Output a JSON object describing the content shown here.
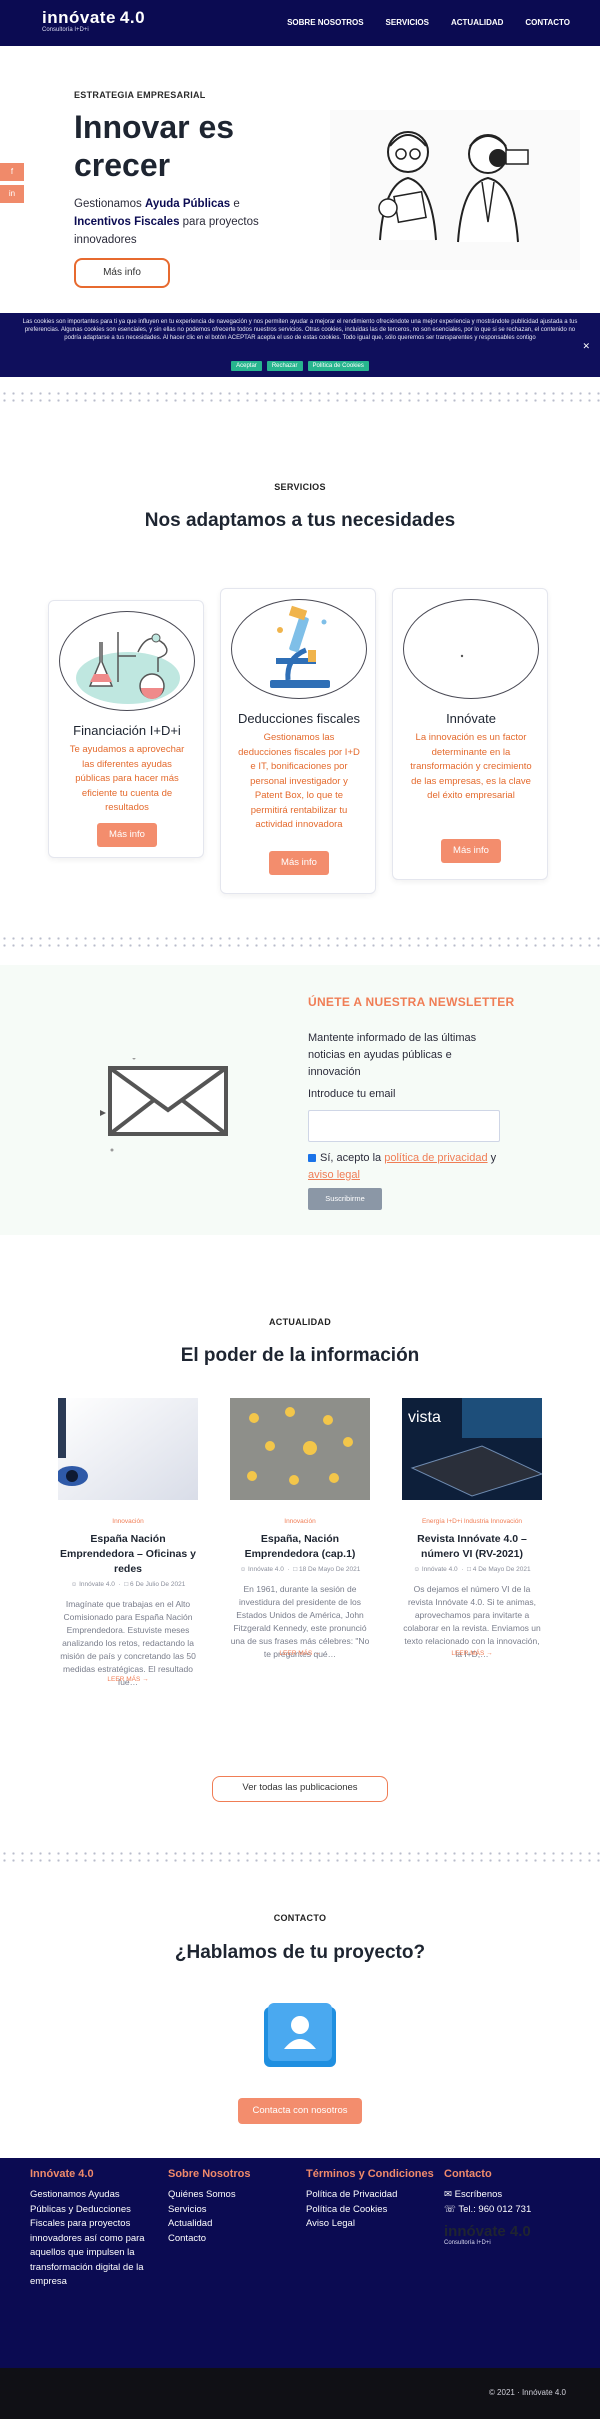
{
  "header": {
    "brand": "innóvate",
    "version": "4.0",
    "tagline": "Consultoría I+D+i",
    "nav": [
      "SOBRE NOSOTROS",
      "SERVICIOS",
      "ACTUALIDAD",
      "CONTACTO"
    ]
  },
  "hero": {
    "eyebrow": "ESTRATEGIA EMPRESARIAL",
    "title": "Innovar es crecer",
    "text_1": "Gestionamos ",
    "text_bold_1": "Ayuda Públicas",
    "text_2": " e ",
    "text_bold_2": "Incentivos Fiscales",
    "text_3": " para proyectos innovadores",
    "button": "Más info",
    "social": [
      "f",
      "in"
    ]
  },
  "cookie": {
    "text": "Las cookies son importantes para ti ya que influyen en tu experiencia de navegación y nos permiten ayudar a mejorar el rendimiento ofreciéndote una mejor experiencia y mostrándote publicidad ajustada a tus preferencias. Algunas cookies son esenciales, y sin ellas no podemos ofrecerte todos nuestros servicios. Otras cookies, incluidas las de terceros, no son esenciales, por lo que si se rechazan, el contenido no podría adaptarse a tus necesidades. Al hacer clic en el botón ACEPTAR acepta el uso de estas cookies. Todo igual que, sólo queremos ser transparentes y responsables contigo",
    "accept": "Aceptar",
    "reject": "Rechazar",
    "policy": "Política de Cookies",
    "close": "✕"
  },
  "services": {
    "eyebrow": "SERVICIOS",
    "title": "Nos adaptamos a tus necesidades",
    "cards": [
      {
        "title": "Financiación I+D+i",
        "text": "Te ayudamos a aprovechar las diferentes ayudas públicas para hacer más eficiente tu cuenta de resultados",
        "button": "Más info"
      },
      {
        "title": "Deducciones fiscales",
        "text": "Gestionamos las deducciones fiscales por I+D e IT, bonificaciones por personal investigador y Patent Box, lo que te permitirá rentabilizar tu actividad innovadora",
        "button": "Más info"
      },
      {
        "title": "Innóvate",
        "text": "La innovación es un factor determinante en la transformación y crecimiento de las empresas, es la clave del éxito empresarial",
        "button": "Más info"
      }
    ]
  },
  "newsletter": {
    "title": "ÚNETE A NUESTRA NEWSLETTER",
    "text": "Mantente informado de las últimas noticias en ayudas públicas e innovación",
    "email_label": "Introduce tu email",
    "email_placeholder": "",
    "consent_1": "Sí, acepto la ",
    "consent_link_1": "política de privacidad",
    "consent_2": " y ",
    "consent_link_2": "aviso legal",
    "button": "Suscribirme"
  },
  "news": {
    "eyebrow": "ACTUALIDAD",
    "title": "El poder de la información",
    "posts": [
      {
        "category": "Innovación",
        "title": "España Nación Emprendedora – Oficinas y redes",
        "author": "Innóvate 4.0",
        "date": "6 De Julio De 2021",
        "excerpt": "Imagínate que trabajas en el Alto Comisionado para España Nación Emprendedora. Estuviste meses analizando los retos, redactando la misión de país y concretando las 50 medidas estratégicas. El resultado fue…",
        "more": "LEER MÁS"
      },
      {
        "category": "Innovación",
        "title": "España, Nación Emprendedora (cap.1)",
        "author": "Innóvate 4.0",
        "date": "18 De Mayo De 2021",
        "excerpt": "En 1961, durante la sesión de investidura del presidente de los Estados Unidos de América, John Fitzgerald Kennedy, este pronunció una de sus frases más célebres: \"No te preguntes qué…",
        "more": "LEER MÁS"
      },
      {
        "category": "Energía I+D+i Industria Innovación",
        "title": "Revista Innóvate 4.0 – número VI (RV-2021)",
        "author": "Innóvate 4.0",
        "date": "4 De Mayo De 2021",
        "excerpt": "Os dejamos el número VI de la revista Innóvate 4.0. Si te animas, aprovechamos para invitarte a colaborar en la revista. Enviamos un texto relacionado con la innovación, la I+D,…",
        "more": "LEER MÁS"
      }
    ],
    "all_button": "Ver todas las publicaciones"
  },
  "contact": {
    "eyebrow": "CONTACTO",
    "title": "¿Hablamos de tu proyecto?",
    "button": "Contacta con nosotros"
  },
  "footer": {
    "col1_title": "Innóvate 4.0",
    "col1_text": "Gestionamos Ayudas Públicas y Deducciones Fiscales para proyectos innovadores así como para aquellos que impulsen la transformación digital de la empresa",
    "col2_title": "Sobre Nosotros",
    "col2_links": [
      "Quiénes Somos",
      "Servicios",
      "Actualidad",
      "Contacto"
    ],
    "col3_title": "Términos y Condiciones",
    "col3_links": [
      "Política de Privacidad",
      "Política de Cookies",
      "Aviso Legal"
    ],
    "col4_title": "Contacto",
    "email": "Escríbenos",
    "phone": "Tel.: 960 012 731",
    "copyright": "© 2021 · Innóvate 4.0"
  },
  "colors": {
    "navy": "#0b0b52",
    "accent": "#f07d55",
    "cta": "#f38d6d",
    "cookie_btn": "#27b58e"
  }
}
